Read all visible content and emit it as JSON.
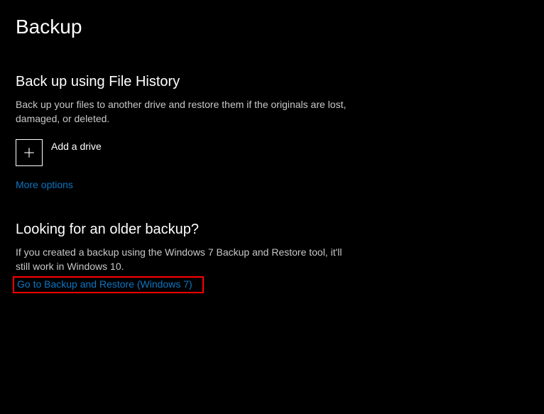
{
  "page": {
    "title": "Backup"
  },
  "fileHistory": {
    "heading": "Back up using File History",
    "description": "Back up your files to another drive and restore them if the originals are lost, damaged, or deleted.",
    "addDriveLabel": "Add a drive",
    "moreOptions": "More options"
  },
  "olderBackup": {
    "heading": "Looking for an older backup?",
    "description": "If you created a backup using the Windows 7 Backup and Restore tool, it'll still work in Windows 10.",
    "link": "Go to Backup and Restore (Windows 7)"
  },
  "colors": {
    "link": "#0c76c4",
    "highlight": "#ff0000"
  }
}
